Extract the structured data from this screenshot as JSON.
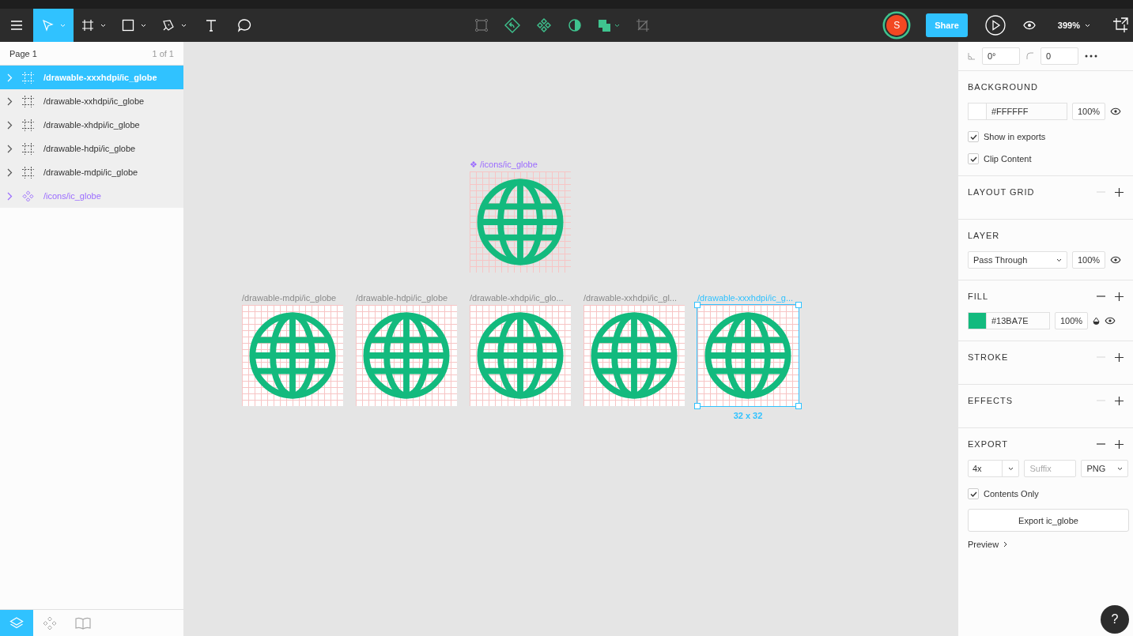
{
  "toolbar": {
    "tools": [
      {
        "kind": "menu",
        "selected": false,
        "dropdown": false
      },
      {
        "kind": "move",
        "selected": true,
        "dropdown": true
      },
      {
        "kind": "frame",
        "selected": false,
        "dropdown": true
      },
      {
        "kind": "rectangle",
        "selected": false,
        "dropdown": true
      },
      {
        "kind": "pen",
        "selected": false,
        "dropdown": true
      },
      {
        "kind": "text",
        "selected": false,
        "dropdown": false
      },
      {
        "kind": "comment",
        "selected": false,
        "dropdown": false
      }
    ],
    "actions": [
      {
        "kind": "select-frame",
        "disabled": true
      },
      {
        "kind": "component-back",
        "disabled": false
      },
      {
        "kind": "component",
        "disabled": false
      },
      {
        "kind": "mask",
        "disabled": false
      },
      {
        "kind": "boolean",
        "disabled": false
      },
      {
        "kind": "crop",
        "disabled": true
      }
    ],
    "avatar": "S",
    "share": "Share",
    "zoom": "399%"
  },
  "layers_panel": {
    "page": "Page 1",
    "page_count": "1 of 1",
    "layers": [
      {
        "name": "/drawable-xxxhdpi/ic_globe",
        "kind": "frame",
        "selected": true
      },
      {
        "name": "/drawable-xxhdpi/ic_globe",
        "kind": "frame",
        "selected": false
      },
      {
        "name": "/drawable-xhdpi/ic_globe",
        "kind": "frame",
        "selected": false
      },
      {
        "name": "/drawable-hdpi/ic_globe",
        "kind": "frame",
        "selected": false
      },
      {
        "name": "/drawable-mdpi/ic_globe",
        "kind": "frame",
        "selected": false
      },
      {
        "name": "/icons/ic_globe",
        "kind": "component",
        "selected": false
      }
    ],
    "bottom_tabs": [
      {
        "kind": "layers",
        "selected": true
      },
      {
        "kind": "components",
        "selected": false
      },
      {
        "kind": "library",
        "selected": false
      }
    ]
  },
  "canvas": {
    "component": {
      "mark": "❖",
      "label": "/icons/ic_globe"
    },
    "frames": [
      {
        "label": "/drawable-mdpi/ic_globe",
        "selected": false
      },
      {
        "label": "/drawable-hdpi/ic_globe",
        "selected": false
      },
      {
        "label": "/drawable-xhdpi/ic_glo...",
        "selected": false
      },
      {
        "label": "/drawable-xxhdpi/ic_gl...",
        "selected": false
      },
      {
        "label": "/drawable-xxxhdpi/ic_g...",
        "selected": true
      }
    ],
    "size_label": "32 x 32"
  },
  "properties": {
    "rotation": "0°",
    "radius": "0",
    "background": {
      "title": "BACKGROUND",
      "color": "#FFFFFF",
      "opacity": "100%",
      "options": [
        {
          "label": "Show in exports",
          "checked": true
        },
        {
          "label": "Clip Content",
          "checked": true
        }
      ]
    },
    "sections": [
      {
        "title": "LAYOUT GRID",
        "removable": false
      },
      {
        "title": "LAYER",
        "kind": "layer",
        "blend": "Pass Through",
        "opacity": "100%"
      },
      {
        "title": "FILL",
        "removable": true,
        "kind": "fill",
        "color": "#13BA7E",
        "opacity": "100%"
      },
      {
        "title": "STROKE",
        "removable": false
      },
      {
        "title": "EFFECTS",
        "removable": false
      }
    ],
    "export": {
      "title": "EXPORT",
      "removable": true,
      "scale": "4x",
      "suffix_placeholder": "Suffix",
      "format": "PNG",
      "contents_only": {
        "label": "Contents Only",
        "checked": true
      },
      "button": "Export ic_globe",
      "preview": "Preview"
    }
  },
  "help": "?"
}
